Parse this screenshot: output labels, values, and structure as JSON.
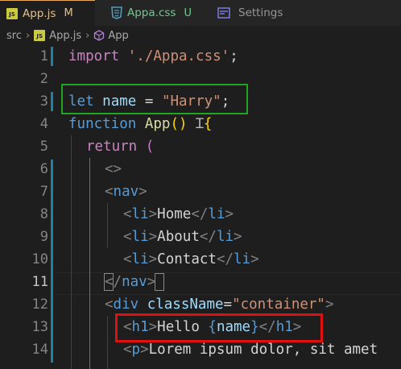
{
  "tabs": [
    {
      "icon": "JS",
      "label": "App.js",
      "status": "M"
    },
    {
      "label": "Appa.css",
      "status": "U"
    },
    {
      "label": "Settings"
    }
  ],
  "breadcrumb": {
    "folder": "src",
    "file_icon": "JS",
    "file": "App.js",
    "symbol": "App"
  },
  "lines": [
    {
      "n": "1"
    },
    {
      "n": "2"
    },
    {
      "n": "3"
    },
    {
      "n": "4"
    },
    {
      "n": "5"
    },
    {
      "n": "6"
    },
    {
      "n": "7"
    },
    {
      "n": "8"
    },
    {
      "n": "9"
    },
    {
      "n": "10"
    },
    {
      "n": "11"
    },
    {
      "n": "12"
    },
    {
      "n": "13"
    },
    {
      "n": "14"
    }
  ],
  "code": {
    "l1": {
      "kw": "import",
      "str": "'./Appa.css'",
      "semi": ";"
    },
    "l3": {
      "kw": "let",
      "name": "name",
      "eq": "=",
      "str": "\"Harry\"",
      "semi": ";"
    },
    "l4": {
      "kw": "function",
      "fn": "App",
      "parens": "()",
      "brace": "{"
    },
    "l5": {
      "kw": "return",
      "paren": "("
    },
    "l6": {
      "frag": "<>"
    },
    "l7": {
      "open": "<",
      "tag": "nav",
      "close": ">"
    },
    "l8": {
      "open": "<",
      "tag": "li",
      "close": ">",
      "text": "Home",
      "end_open": "</",
      "end_tag": "li",
      "end_close": ">"
    },
    "l9": {
      "open": "<",
      "tag": "li",
      "close": ">",
      "text": "About",
      "end_open": "</",
      "end_tag": "li",
      "end_close": ">"
    },
    "l10": {
      "open": "<",
      "tag": "li",
      "close": ">",
      "text": "Contact",
      "end_open": "</",
      "end_tag": "li",
      "end_close": ">"
    },
    "l11": {
      "open": "</",
      "tag": "nav",
      "close": ">"
    },
    "l12": {
      "open": "<",
      "tag": "div",
      "attr": "className",
      "eq": "=",
      "str": "\"container\"",
      "close": ">"
    },
    "l13": {
      "open": "<",
      "tag": "h1",
      "close": ">",
      "text": "Hello ",
      "lb": "{",
      "var": "name",
      "rb": "}",
      "end_open": "</",
      "end_tag": "h1",
      "end_close": ">"
    },
    "l14": {
      "open": "<",
      "tag": "p",
      "close": ">",
      "text": "Lorem ipsum dolor, sit amet"
    }
  },
  "colors": {
    "keyword": "#569cd6",
    "string": "#ce9178",
    "highlight_green": "#1fa51f",
    "highlight_red": "#e01010"
  }
}
